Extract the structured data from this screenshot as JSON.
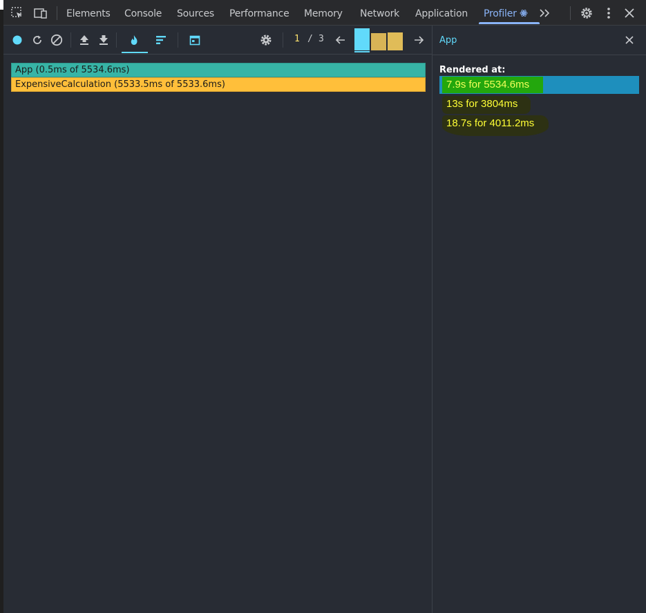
{
  "devtools_tabs": [
    {
      "label": "Elements",
      "active": false
    },
    {
      "label": "Console",
      "active": false
    },
    {
      "label": "Sources",
      "active": false
    },
    {
      "label": "Performance",
      "active": false
    },
    {
      "label": "Memory",
      "active": false
    },
    {
      "label": "Network",
      "active": false
    },
    {
      "label": "Application",
      "active": false
    },
    {
      "label": "Profiler",
      "active": true
    }
  ],
  "profiler": {
    "commit_current": "1",
    "commit_separator": "/",
    "commit_total": "3",
    "commit_bars": [
      {
        "color": "#61dafb",
        "level": 1.0,
        "selected": true
      },
      {
        "color": "#d8b456",
        "level": 0.78,
        "selected": false
      },
      {
        "color": "#e0bc58",
        "level": 0.82,
        "selected": false
      }
    ]
  },
  "flame": {
    "rows": [
      {
        "label": "App (0.5ms of 5534.6ms)",
        "color": "#37b4a6"
      },
      {
        "label": "ExpensiveCalculation (5533.5ms of 5533.6ms)",
        "color": "#ffbf3a"
      }
    ]
  },
  "sidebar": {
    "title": "App",
    "rendered_at_label": "Rendered at:",
    "renders": [
      {
        "text": "7.9s for 5534.6ms",
        "selected": true
      },
      {
        "text": "13s for 3804ms",
        "selected": false
      },
      {
        "text": "18.7s for 4011.2ms",
        "selected": false
      }
    ]
  },
  "colors": {
    "react_accent": "#61dafb",
    "devtools_active_tab": "#8ab4f8",
    "panel_bg": "#282c34"
  }
}
